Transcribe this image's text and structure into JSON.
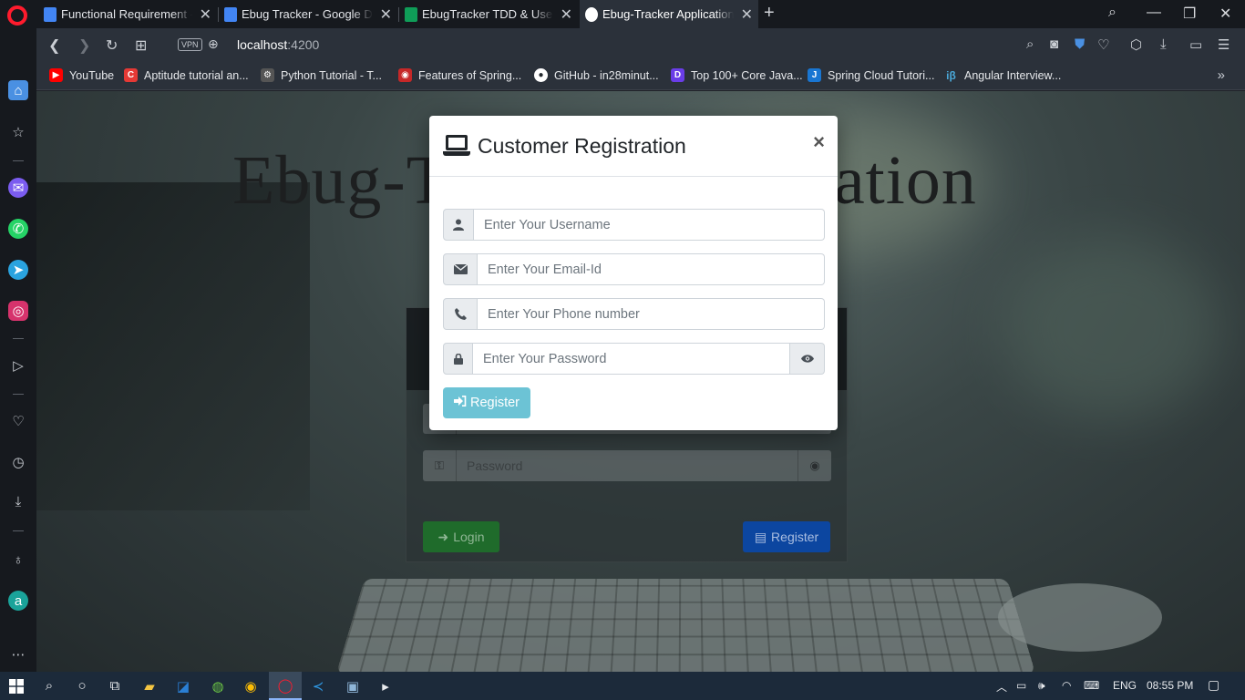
{
  "tabs": [
    {
      "label": "Functional Requirement - G",
      "favicon_color": "#4285f4",
      "active": false
    },
    {
      "label": "Ebug Tracker - Google Doc",
      "favicon_color": "#4285f4",
      "active": false
    },
    {
      "label": "EbugTracker TDD & UserSto",
      "favicon_color": "#0f9d58",
      "active": false
    },
    {
      "label": "Ebug-Tracker Application",
      "favicon_color": "#ffffff",
      "active": true
    }
  ],
  "address": {
    "host": "localhost",
    "port": ":4200",
    "vpn_label": "VPN"
  },
  "bookmarks": [
    {
      "label": "YouTube",
      "icon": "youtube-icon",
      "color": "#ff0000",
      "glyph": "▶"
    },
    {
      "label": "Aptitude tutorial an...",
      "icon": "c-icon",
      "color": "#e53935",
      "glyph": "C"
    },
    {
      "label": "Python Tutorial - T...",
      "icon": "python-icon",
      "color": "#555555",
      "glyph": "⚙"
    },
    {
      "label": "Features of Spring...",
      "icon": "spring-icon",
      "color": "#c62828",
      "glyph": "◉"
    },
    {
      "label": "GitHub - in28minut...",
      "icon": "github-icon",
      "color": "#2b313a",
      "glyph": "●"
    },
    {
      "label": "Top 100+ Core Java...",
      "icon": "java-icon",
      "color": "#6a3de8",
      "glyph": "D"
    },
    {
      "label": "Spring Cloud Tutori...",
      "icon": "javatpoint-icon",
      "color": "#1976d2",
      "glyph": "J"
    },
    {
      "label": "Angular Interview...",
      "icon": "interviewbit-icon",
      "color": "#2b313a",
      "glyph": "iβ"
    }
  ],
  "page": {
    "hero_title": "Ebug-Tracker Application",
    "login": {
      "password_placeholder": "Password",
      "login_label": "Login",
      "register_label": "Register"
    }
  },
  "modal": {
    "title": "Customer Registration",
    "close": "×",
    "username_placeholder": "Enter Your Username",
    "email_placeholder": "Enter Your Email-Id",
    "phone_placeholder": "Enter Your Phone number",
    "password_placeholder": "Enter Your Password",
    "register_label": "Register"
  },
  "taskbar": {
    "language": "ENG",
    "time": "08:55 PM"
  },
  "colors": {
    "accent_info": "#6cc3d5",
    "opera_red": "#ff1b2d"
  }
}
